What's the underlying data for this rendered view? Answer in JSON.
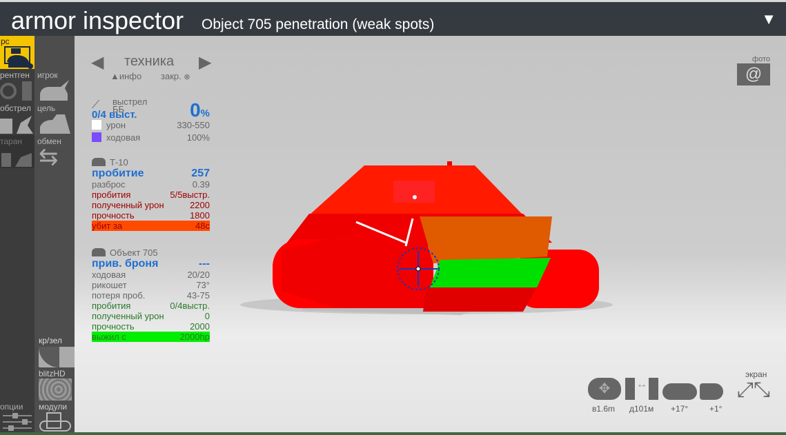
{
  "title": {
    "app": "armor inspector",
    "subtitle": "Object 705 penetration (weak spots)",
    "menu_icon": "triangle-down-icon"
  },
  "sidebar": {
    "items": [
      {
        "label": "pc",
        "active": true
      },
      {
        "label": "рентген"
      },
      {
        "label": "игрок"
      },
      {
        "label": "обстрел"
      },
      {
        "label": "цель"
      },
      {
        "label": "таран"
      },
      {
        "label": "обмен"
      },
      {
        "label": "кр/зел"
      },
      {
        "label": "blitzHD"
      },
      {
        "label": "опции"
      },
      {
        "label": "модули"
      }
    ],
    "active_color": "#f5c400"
  },
  "nav": {
    "title": "техника",
    "info": "▲инфо",
    "close": "закр."
  },
  "shot": {
    "label": "выстрел",
    "ammo": "ББ",
    "shots": "0/4 выст.",
    "percent": "0",
    "percent_unit": "%",
    "rows": [
      {
        "label": "урон",
        "value": "330-550",
        "color": "#ffffff"
      },
      {
        "label": "ходовая",
        "value": "100%",
        "color": "#7a4cff"
      }
    ]
  },
  "attacker": {
    "name": "Т-10",
    "pen_label": "пробитие",
    "pen_value": "257",
    "spread_label": "разброс",
    "spread_value": "0.39",
    "rows": [
      {
        "label": "пробития",
        "value": "5/5выстр."
      },
      {
        "label": "полученный урон",
        "value": "2200"
      },
      {
        "label": "прочность",
        "value": "1800"
      }
    ],
    "killed_label": "убит за",
    "killed_value": "48с",
    "killed_color": "#ff4a00"
  },
  "target": {
    "name": "Объект 705",
    "armor_label": "прив. броня",
    "armor_value": "---",
    "gray_rows": [
      {
        "label": "ходовая",
        "value": "20/20"
      },
      {
        "label": "рикошет",
        "value": "73°"
      },
      {
        "label": "потеря проб.",
        "value": "43-75"
      }
    ],
    "green_rows": [
      {
        "label": "пробития",
        "value": "0/4выстр."
      },
      {
        "label": "полученный урон",
        "value": "0"
      },
      {
        "label": "прочность",
        "value": "2000"
      }
    ],
    "survived_label": "выжил с",
    "survived_value": "2000hp",
    "survived_color": "#00ee00"
  },
  "photo": {
    "label": "фото"
  },
  "controls": {
    "screen": "экран",
    "height": "в1.6m",
    "distance": "д101м",
    "angle1": "+17°",
    "angle2": "+1°"
  }
}
